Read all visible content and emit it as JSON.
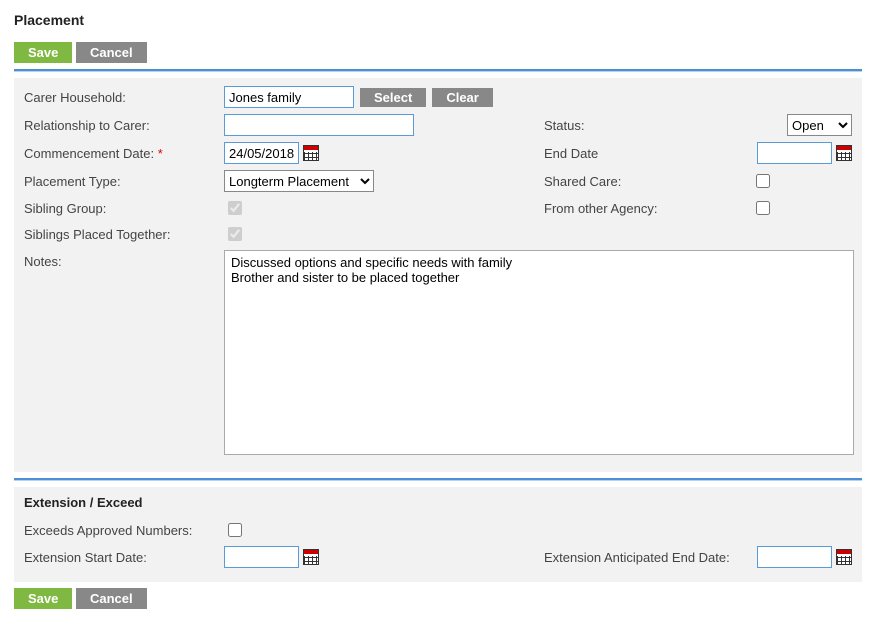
{
  "title": "Placement",
  "buttons": {
    "save": "Save",
    "cancel": "Cancel",
    "select": "Select",
    "clear": "Clear"
  },
  "section1": {
    "carer_household_label": "Carer Household:",
    "carer_household_value": "Jones family",
    "relationship_label": "Relationship to Carer:",
    "relationship_value": "",
    "status_label": "Status:",
    "status_value": "Open",
    "commencement_label": "Commencement Date:",
    "commencement_value": "24/05/2018",
    "end_date_label": "End Date",
    "end_date_value": "",
    "placement_type_label": "Placement Type:",
    "placement_type_value": "Longterm Placement",
    "shared_care_label": "Shared Care:",
    "shared_care_checked": false,
    "sibling_group_label": "Sibling Group:",
    "sibling_group_checked": true,
    "from_other_agency_label": "From other Agency:",
    "from_other_agency_checked": false,
    "siblings_together_label": "Siblings Placed Together:",
    "siblings_together_checked": true,
    "notes_label": "Notes:",
    "notes_value": "Discussed options and specific needs with family\nBrother and sister to be placed together"
  },
  "section2": {
    "heading": "Extension / Exceed",
    "exceeds_label": "Exceeds Approved Numbers:",
    "exceeds_checked": false,
    "ext_start_label": "Extension Start Date:",
    "ext_start_value": "",
    "ext_end_label": "Extension Anticipated End Date:",
    "ext_end_value": ""
  }
}
